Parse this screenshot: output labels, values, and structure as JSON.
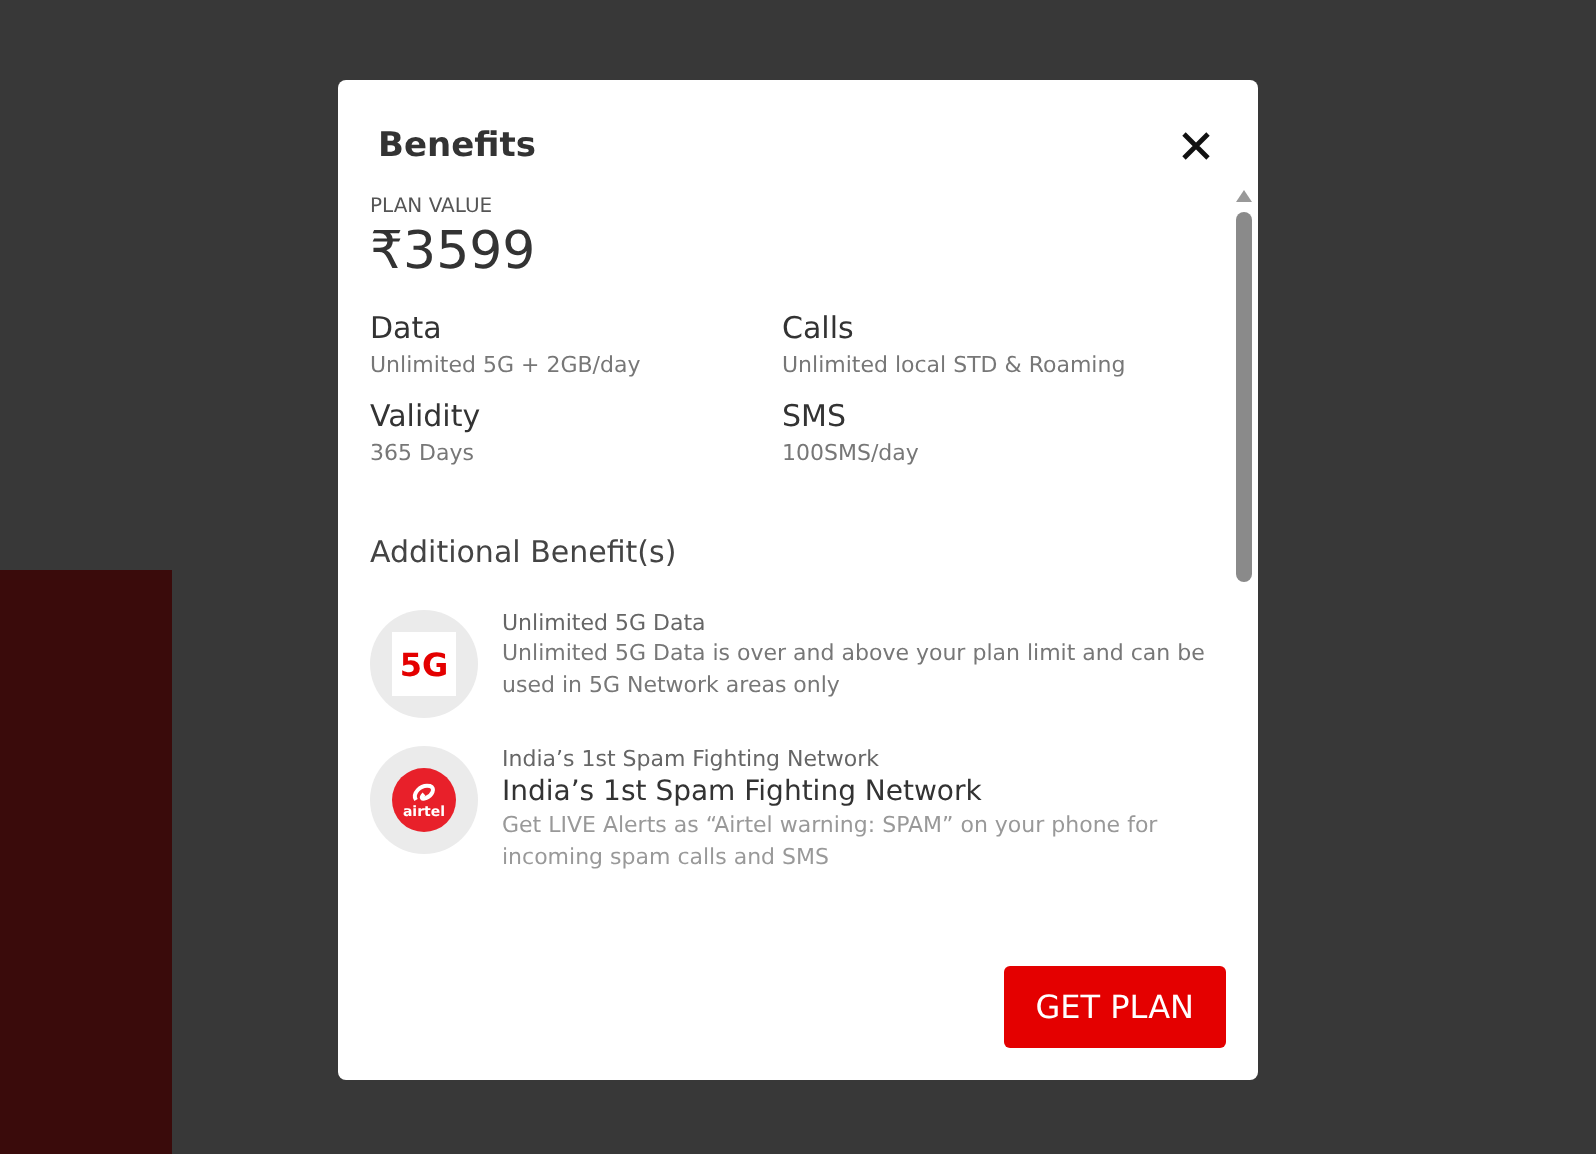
{
  "dialog": {
    "title": "Benefits",
    "plan_value": {
      "label": "PLAN VALUE",
      "amount": "₹3599"
    },
    "details": [
      {
        "name": "Data",
        "value": "Unlimited 5G + 2GB/day"
      },
      {
        "name": "Calls",
        "value": "Unlimited local STD & Roaming"
      },
      {
        "name": "Validity",
        "value": "365 Days"
      },
      {
        "name": "SMS",
        "value": "100SMS/day"
      }
    ],
    "additional_title": "Additional Benefit(s)",
    "benefits": [
      {
        "kind": "badge",
        "badge_text": "5G",
        "caption": "Unlimited 5G Data",
        "description": "Unlimited 5G Data is over and above your plan limit and can be used in 5G Network areas only"
      },
      {
        "kind": "logo",
        "logo_text": "airtel",
        "caption": "India’s 1st Spam Fighting Network",
        "headline": "India’s 1st Spam Fighting Network",
        "description": "Get LIVE Alerts as “Airtel warning: SPAM” on your phone for incoming spam calls and SMS"
      }
    ],
    "button": "GET PLAN"
  }
}
